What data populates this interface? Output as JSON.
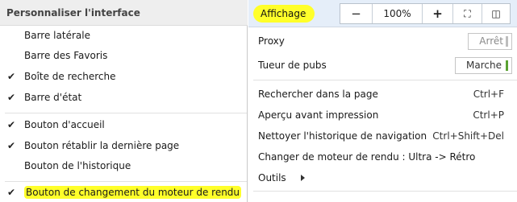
{
  "left": {
    "header": "Personnaliser l'interface",
    "check_glyph": "✔",
    "items": [
      {
        "label": "Barre latérale",
        "checked": false
      },
      {
        "label": "Barre des Favoris",
        "checked": false
      },
      {
        "label": "Boîte de recherche",
        "checked": true
      },
      {
        "label": "Barre d'état",
        "checked": true
      },
      {
        "label": "Bouton d'accueil",
        "checked": true
      },
      {
        "label": "Bouton rétablir la dernière page",
        "checked": true
      },
      {
        "label": "Bouton de l'historique",
        "checked": false
      },
      {
        "label": "Bouton de changement du moteur de rendu",
        "checked": true,
        "highlighted": true
      }
    ]
  },
  "right": {
    "view_label": "Affichage",
    "zoom": {
      "minus": "−",
      "value": "100%",
      "plus": "+",
      "fullscreen_icon": "⛶",
      "sidebar_icon": "◫"
    },
    "proxy": {
      "label": "Proxy",
      "toggle": "Arrêt",
      "state": "off"
    },
    "adblock": {
      "label": "Tueur de pubs",
      "toggle": "Marche",
      "state": "on"
    },
    "find": {
      "label": "Rechercher dans la page",
      "shortcut": "Ctrl+F"
    },
    "print_preview": {
      "label": "Aperçu avant impression",
      "shortcut": "Ctrl+P"
    },
    "clear_history": {
      "label": "Nettoyer l'historique de navigation",
      "shortcut": "Ctrl+Shift+Del"
    },
    "switch_engine": {
      "label": "Changer de moteur de rendu : Ultra -> Rétro"
    },
    "tools": {
      "label": "Outils"
    }
  },
  "colors": {
    "highlight": "#ffff2a",
    "toolbar_bg": "#e5eef9",
    "toggle_on": "#5aa232",
    "toggle_off": "#bdbdbd"
  }
}
